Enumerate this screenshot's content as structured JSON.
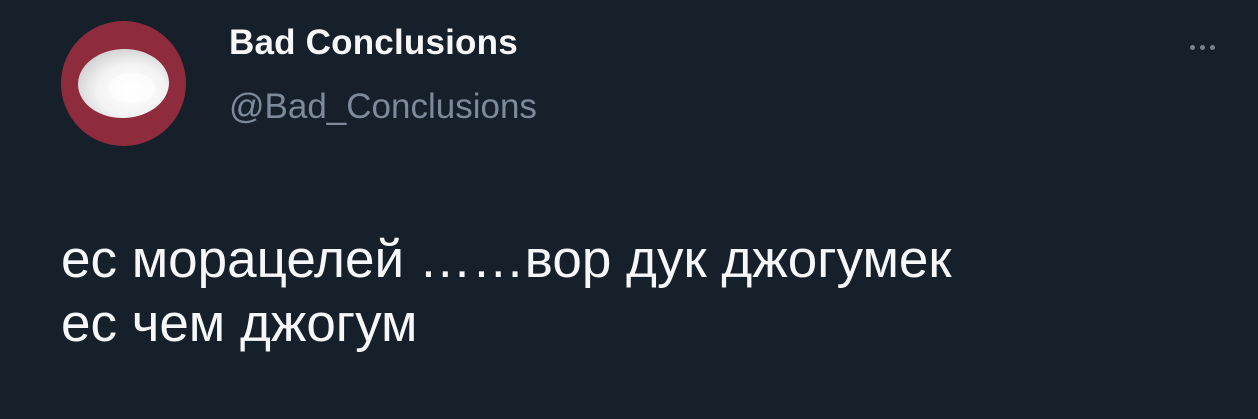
{
  "tweet": {
    "author": {
      "display_name": "Bad Conclusions",
      "handle": "@Bad_Conclusions",
      "avatar_icon": "white-oval-avatar-icon"
    },
    "text_lines": [
      "ес морацелей ……вор дук джогумек",
      "ес чем джогум"
    ],
    "more_icon": "more-options-icon"
  },
  "colors": {
    "background": "#16202b",
    "avatar_background": "#8e2c3e",
    "primary_text": "#f5f7f9",
    "secondary_text": "#7c8a99"
  }
}
